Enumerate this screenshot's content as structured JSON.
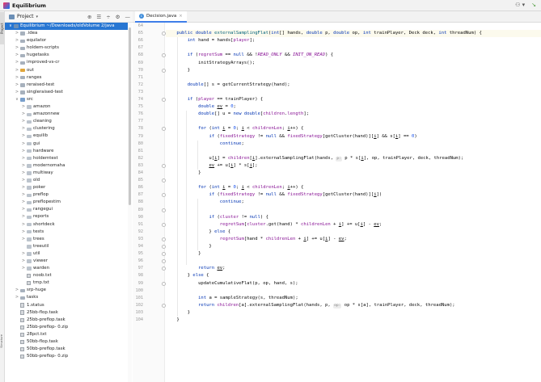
{
  "titlebar": {
    "project_name": "Equilibrium",
    "user_label": "⚇ ▾",
    "vcs_icon_char": "↘"
  },
  "left_strip": {
    "project_label": "Project",
    "structure_label": "Structure"
  },
  "project_panel": {
    "view_label": "Project",
    "tool_icons": [
      "⊕",
      "☰",
      "÷",
      "⚙",
      "—"
    ]
  },
  "tree": [
    {
      "depth": 0,
      "chev": "∨",
      "icon": "mod",
      "label": "Equilibrium ~/Downloads/oldVolume 2/java",
      "selected": true
    },
    {
      "depth": 1,
      "chev": ">",
      "icon": "folder",
      "label": ".idea"
    },
    {
      "depth": 1,
      "chev": ">",
      "icon": "folder",
      "label": "equilator"
    },
    {
      "depth": 1,
      "chev": ">",
      "icon": "folder",
      "label": "holdem-scripts"
    },
    {
      "depth": 1,
      "chev": ">",
      "icon": "folder",
      "label": "hugetasks"
    },
    {
      "depth": 1,
      "chev": ">",
      "icon": "folder",
      "label": "improved-vs-cr"
    },
    {
      "depth": 1,
      "chev": ">",
      "icon": "folder-out",
      "label": "out"
    },
    {
      "depth": 1,
      "chev": ">",
      "icon": "folder",
      "label": "ranges"
    },
    {
      "depth": 1,
      "chev": ">",
      "icon": "folder",
      "label": "reraised-test"
    },
    {
      "depth": 1,
      "chev": ">",
      "icon": "folder",
      "label": "singleraised-test"
    },
    {
      "depth": 1,
      "chev": "∨",
      "icon": "folder-src",
      "label": "src"
    },
    {
      "depth": 2,
      "chev": ">",
      "icon": "pkg",
      "label": "amazon"
    },
    {
      "depth": 2,
      "chev": ">",
      "icon": "pkg",
      "label": "amazonnew"
    },
    {
      "depth": 2,
      "chev": ">",
      "icon": "pkg",
      "label": "cleaning"
    },
    {
      "depth": 2,
      "chev": ">",
      "icon": "pkg",
      "label": "clustering"
    },
    {
      "depth": 2,
      "chev": ">",
      "icon": "pkg",
      "label": "equilib"
    },
    {
      "depth": 2,
      "chev": ">",
      "icon": "pkg",
      "label": "gui"
    },
    {
      "depth": 2,
      "chev": ">",
      "icon": "pkg",
      "label": "hardware"
    },
    {
      "depth": 2,
      "chev": ">",
      "icon": "pkg",
      "label": "holdemtest"
    },
    {
      "depth": 2,
      "chev": ">",
      "icon": "pkg",
      "label": "modernomaha"
    },
    {
      "depth": 2,
      "chev": ">",
      "icon": "pkg",
      "label": "multiway"
    },
    {
      "depth": 2,
      "chev": ">",
      "icon": "pkg",
      "label": "old"
    },
    {
      "depth": 2,
      "chev": ">",
      "icon": "pkg",
      "label": "poker"
    },
    {
      "depth": 2,
      "chev": ">",
      "icon": "pkg",
      "label": "preflop"
    },
    {
      "depth": 2,
      "chev": ">",
      "icon": "pkg",
      "label": "preflopestim"
    },
    {
      "depth": 2,
      "chev": ">",
      "icon": "pkg",
      "label": "rangegui"
    },
    {
      "depth": 2,
      "chev": ">",
      "icon": "pkg",
      "label": "reports"
    },
    {
      "depth": 2,
      "chev": ">",
      "icon": "pkg",
      "label": "shortdeck"
    },
    {
      "depth": 2,
      "chev": ">",
      "icon": "pkg",
      "label": "tests"
    },
    {
      "depth": 2,
      "chev": ">",
      "icon": "pkg",
      "label": "trees"
    },
    {
      "depth": 2,
      "chev": "",
      "icon": "pkg",
      "label": "treeutil"
    },
    {
      "depth": 2,
      "chev": ">",
      "icon": "pkg",
      "label": "util"
    },
    {
      "depth": 2,
      "chev": ">",
      "icon": "pkg",
      "label": "viewer"
    },
    {
      "depth": 2,
      "chev": ">",
      "icon": "pkg",
      "label": "warden"
    },
    {
      "depth": 2,
      "chev": "",
      "icon": "file",
      "label": "noob.txt"
    },
    {
      "depth": 2,
      "chev": "",
      "icon": "file",
      "label": "tmp.txt"
    },
    {
      "depth": 1,
      "chev": ">",
      "icon": "folder",
      "label": "srp-huge"
    },
    {
      "depth": 1,
      "chev": ">",
      "icon": "folder",
      "label": "tasks"
    },
    {
      "depth": 1,
      "chev": "",
      "icon": "file",
      "label": "1.status"
    },
    {
      "depth": 1,
      "chev": "",
      "icon": "file",
      "label": "25bb-flop.task"
    },
    {
      "depth": 1,
      "chev": "",
      "icon": "file",
      "label": "25bb-preflop.task"
    },
    {
      "depth": 1,
      "chev": "",
      "icon": "file",
      "label": "25bb-preflop- 0.zip"
    },
    {
      "depth": 1,
      "chev": "",
      "icon": "file",
      "label": "28pct.txt"
    },
    {
      "depth": 1,
      "chev": "",
      "icon": "file",
      "label": "50bb-flop.task"
    },
    {
      "depth": 1,
      "chev": "",
      "icon": "file",
      "label": "50bb-preflop.task"
    },
    {
      "depth": 1,
      "chev": "",
      "icon": "file",
      "label": "50bb-preflop- 0.zip"
    }
  ],
  "editor": {
    "tab_label": "Decision.java",
    "tab_close": "×",
    "lines": [
      {
        "n": "64",
        "cur": false,
        "html": ""
      },
      {
        "n": "65",
        "cur": true,
        "html": "    <span class='kw'>public double</span> <span class='fn'>externalSamplingFlat</span>(<span class='kw'>int</span>[] hands, <span class='kw'>double</span> p, <span class='kw'>double</span> op, <span class='kw'>int</span> trainPlayer, Deck deck, <span class='kw'>int</span> threadNum) {"
      },
      {
        "n": "66",
        "cur": false,
        "html": "        <span class='kw'>int</span> hand = hands[<span class='fld'>player</span>];"
      },
      {
        "n": "67",
        "cur": false,
        "html": ""
      },
      {
        "n": "68",
        "cur": false,
        "html": "        <span class='kw'>if</span> (<span class='fld'>regretSum</span> == <span class='kw'>null</span> &amp;&amp; !<span class='st'>READ_ONLY</span> &amp;&amp; <span class='st'>INIT_ON_READ</span>) {"
      },
      {
        "n": "69",
        "cur": false,
        "html": "            initStrategyArrays();"
      },
      {
        "n": "70",
        "cur": false,
        "html": "        }"
      },
      {
        "n": "71",
        "cur": false,
        "html": ""
      },
      {
        "n": "72",
        "cur": false,
        "html": "        <span class='kw'>double</span>[] s = getCurrentStrategy(hand);"
      },
      {
        "n": "73",
        "cur": false,
        "html": ""
      },
      {
        "n": "74",
        "cur": false,
        "html": "        <span class='kw'>if</span> (<span class='fld'>player</span> == trainPlayer) {"
      },
      {
        "n": "75",
        "cur": false,
        "html": "            <span class='kw'>double</span> <span class='lv'>ev</span> = <span class='num'>0</span>;"
      },
      {
        "n": "76",
        "cur": false,
        "html": "            <span class='kw'>double</span>[] u = <span class='kw'>new double</span>[<span class='fld'>children</span>.<span class='fld'>length</span>];"
      },
      {
        "n": "77",
        "cur": false,
        "html": ""
      },
      {
        "n": "78",
        "cur": false,
        "html": "            <span class='kw'>for</span> (<span class='kw'>int</span> <span class='lv'>i</span> = <span class='num'>0</span>; <span class='lv'>i</span> &lt; <span class='fld'>childrenLen</span>; <span class='lv'>i</span>++) {"
      },
      {
        "n": "79",
        "cur": false,
        "html": "                <span class='kw'>if</span> (<span class='fld'>fixedStrategy</span> != <span class='kw'>null</span> &amp;&amp; <span class='fld'>fixedStrategy</span>[getCluster(hand)][<span class='lv'>i</span>] &amp;&amp; s[<span class='lv'>i</span>] == <span class='num'>0</span>)"
      },
      {
        "n": "80",
        "cur": false,
        "html": "                    <span class='kw'>continue</span>;"
      },
      {
        "n": "81",
        "cur": false,
        "html": ""
      },
      {
        "n": "82",
        "cur": false,
        "html": "                u[<span class='lv'>i</span>] = <span class='fld'>children</span>[<span class='lv'>i</span>].externalSamplingFlat(hands, <span class='hint'>p:</span> p * s[<span class='lv'>i</span>], op, trainPlayer, deck, threadNum);"
      },
      {
        "n": "83",
        "cur": false,
        "html": "                <span class='lv'>ev</span> += u[<span class='lv'>i</span>] * s[<span class='lv'>i</span>];"
      },
      {
        "n": "84",
        "cur": false,
        "html": "            }"
      },
      {
        "n": "85",
        "cur": false,
        "html": ""
      },
      {
        "n": "86",
        "cur": false,
        "html": "            <span class='kw'>for</span> (<span class='kw'>int</span> <span class='lv'>i</span> = <span class='num'>0</span>; <span class='lv'>i</span> &lt; <span class='fld'>childrenLen</span>; <span class='lv'>i</span>++) {"
      },
      {
        "n": "87",
        "cur": false,
        "html": "                <span class='kw'>if</span> (<span class='fld'>fixedStrategy</span> != <span class='kw'>null</span> &amp;&amp; <span class='fld'>fixedStrategy</span>[getCluster(hand)][<span class='lv'>i</span>])"
      },
      {
        "n": "88",
        "cur": false,
        "html": "                    <span class='kw'>continue</span>;"
      },
      {
        "n": "89",
        "cur": false,
        "html": ""
      },
      {
        "n": "90",
        "cur": false,
        "html": "                <span class='kw'>if</span> (<span class='fld'>cluster</span> != <span class='kw'>null</span>) {"
      },
      {
        "n": "91",
        "cur": false,
        "html": "                    <span class='fld'>regretSum</span>[<span class='fld'>cluster</span>.get(hand) * <span class='fld'>childrenLen</span> + <span class='lv'>i</span>] += u[<span class='lv'>i</span>] - <span class='lv'>ev</span>;"
      },
      {
        "n": "92",
        "cur": false,
        "html": "                } <span class='kw'>else</span> {"
      },
      {
        "n": "93",
        "cur": false,
        "html": "                    <span class='fld'>regretSum</span>[hand * <span class='fld'>childrenLen</span> + <span class='lv'>i</span>] += u[<span class='lv'>i</span>] - <span class='lv'>ev</span>;"
      },
      {
        "n": "94",
        "cur": false,
        "html": "                }"
      },
      {
        "n": "95",
        "cur": false,
        "html": "            }"
      },
      {
        "n": "96",
        "cur": false,
        "html": ""
      },
      {
        "n": "97",
        "cur": false,
        "html": "            <span class='kw'>return</span> <span class='lv'>ev</span>;"
      },
      {
        "n": "98",
        "cur": false,
        "html": "        } <span class='kw'>else</span> {"
      },
      {
        "n": "99",
        "cur": false,
        "html": "            updateCumulativeFlat(p, op, hand, s);"
      },
      {
        "n": "100",
        "cur": false,
        "html": ""
      },
      {
        "n": "101",
        "cur": false,
        "html": "            <span class='kw'>int</span> a = sampleStrategy(s, threadNum);"
      },
      {
        "n": "102",
        "cur": false,
        "html": "            <span class='kw'>return</span> <span class='fld'>children</span>[a].externalSamplingFlat(hands, p, <span class='hint'>op:</span> op * s[a], trainPlayer, deck, threadNum);"
      },
      {
        "n": "103",
        "cur": false,
        "html": "        }"
      },
      {
        "n": "104",
        "cur": false,
        "html": "    }"
      }
    ]
  },
  "colors": {
    "selection": "#2776d2",
    "keyword": "#0033b3",
    "method": "#00627a",
    "field": "#871094",
    "number": "#1750eb"
  }
}
